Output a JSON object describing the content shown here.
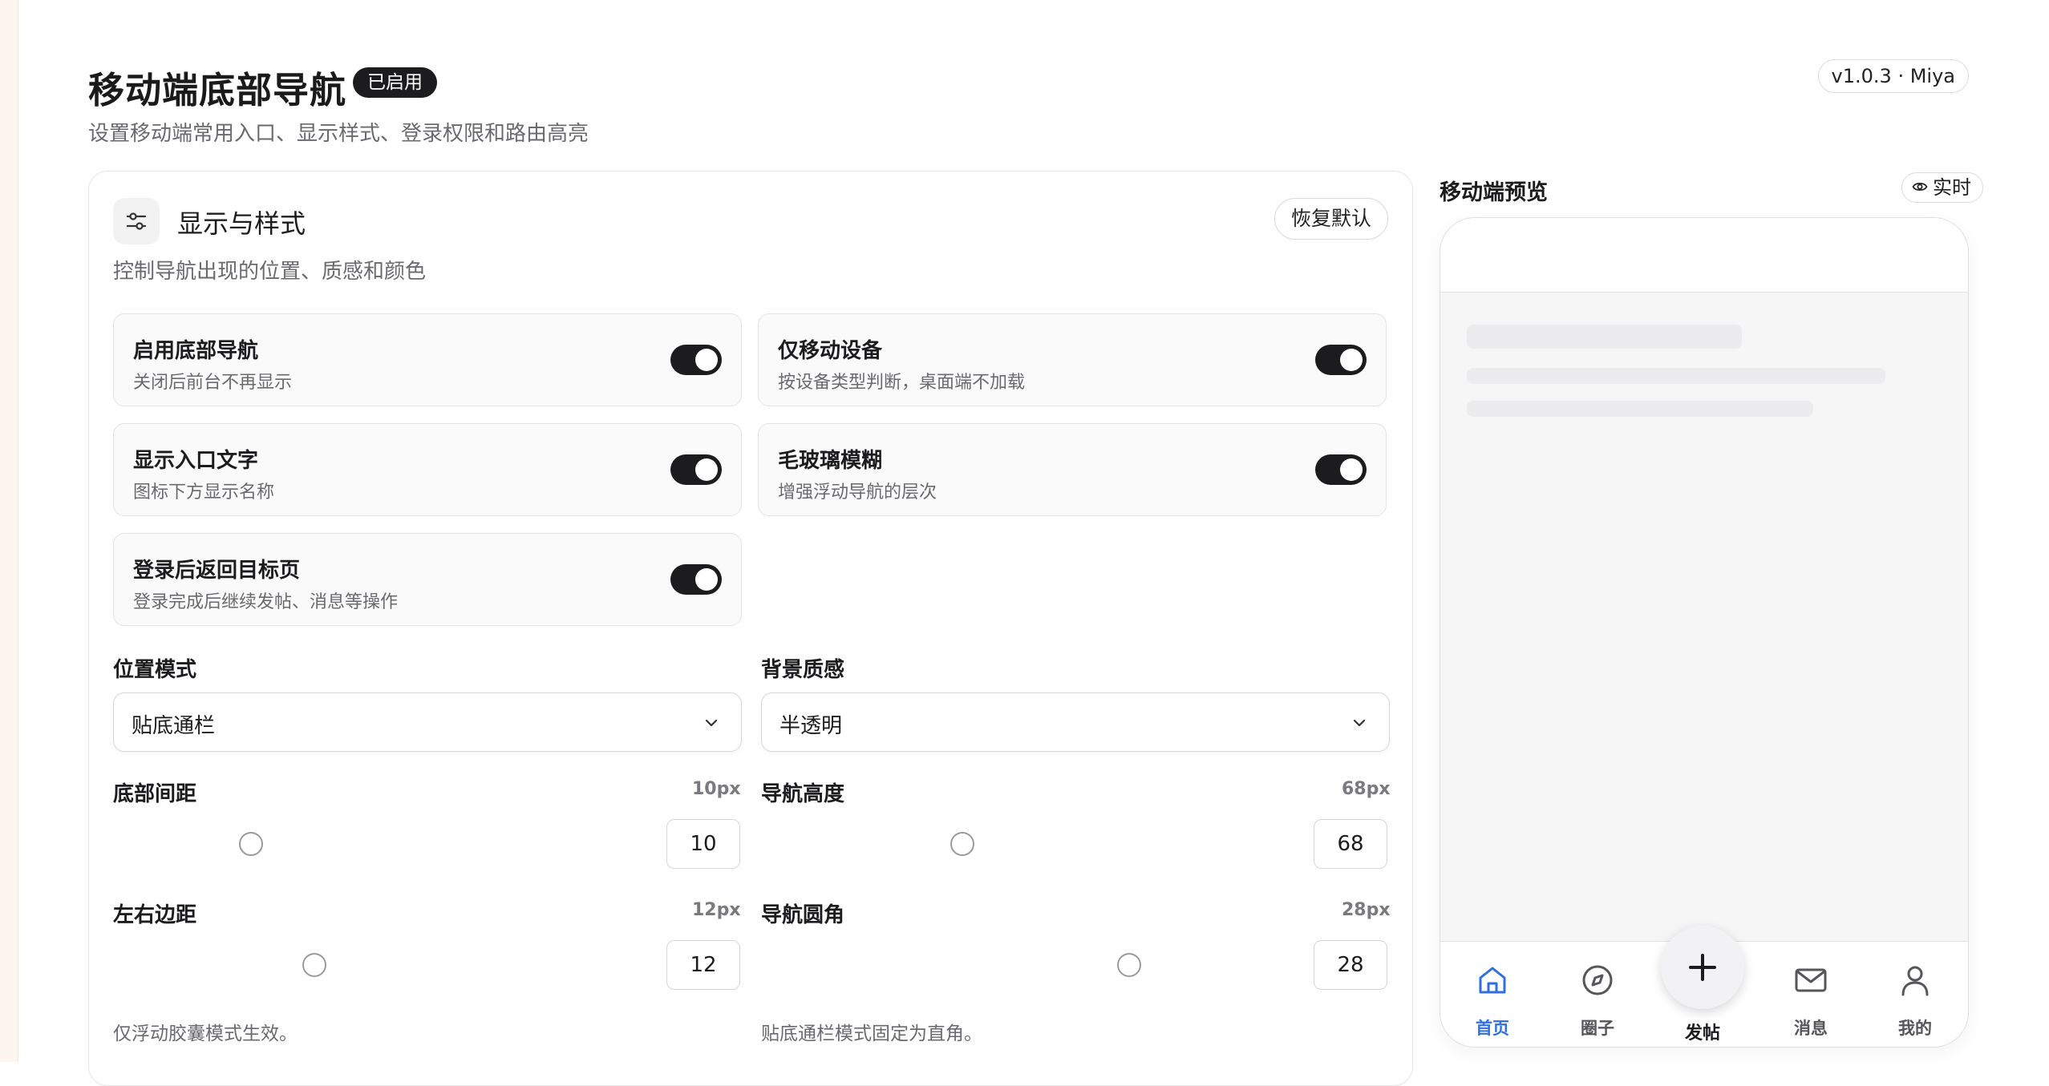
{
  "header": {
    "title": "移动端底部导航",
    "badge": "已启用",
    "subtitle": "设置移动端常用入口、显示样式、登录权限和路由高亮",
    "version": "v1.0.3 · Miya"
  },
  "panel": {
    "icon": "sliders-icon",
    "title": "显示与样式",
    "reset_label": "恢复默认",
    "description": "控制导航出现的位置、质感和颜色"
  },
  "toggles": [
    {
      "title": "启用底部导航",
      "desc": "关闭后前台不再显示",
      "on": true
    },
    {
      "title": "仅移动设备",
      "desc": "按设备类型判断，桌面端不加载",
      "on": true
    },
    {
      "title": "显示入口文字",
      "desc": "图标下方显示名称",
      "on": true
    },
    {
      "title": "毛玻璃模糊",
      "desc": "增强浮动导航的层次",
      "on": true
    },
    {
      "title": "登录后返回目标页",
      "desc": "登录完成后继续发帖、消息等操作",
      "on": true
    }
  ],
  "selects": {
    "position": {
      "label": "位置模式",
      "value": "贴底通栏"
    },
    "background": {
      "label": "背景质感",
      "value": "半透明"
    }
  },
  "sliders": {
    "bottom_spacing": {
      "label": "底部间距",
      "display": "10px",
      "value": "10"
    },
    "nav_height": {
      "label": "导航高度",
      "display": "68px",
      "value": "68"
    },
    "side_spacing": {
      "label": "左右边距",
      "display": "12px",
      "value": "12"
    },
    "nav_radius": {
      "label": "导航圆角",
      "display": "28px",
      "value": "28"
    }
  },
  "hints": {
    "side_spacing": "仅浮动胶囊模式生效。",
    "nav_radius": "贴底通栏模式固定为直角。"
  },
  "preview": {
    "title": "移动端预览",
    "live_label": "实时",
    "live_icon": "eye-icon",
    "nav": [
      {
        "label": "首页",
        "icon": "home-icon",
        "active": true
      },
      {
        "label": "圈子",
        "icon": "compass-icon",
        "active": false
      },
      {
        "label": "发帖",
        "icon": "plus-icon",
        "active": false
      },
      {
        "label": "消息",
        "icon": "mail-icon",
        "active": false
      },
      {
        "label": "我的",
        "icon": "user-icon",
        "active": false
      }
    ]
  },
  "colors": {
    "accent": "#2f6fe0",
    "switch_on": "#1c1c1e",
    "badge_bg": "#1c1c1e"
  }
}
